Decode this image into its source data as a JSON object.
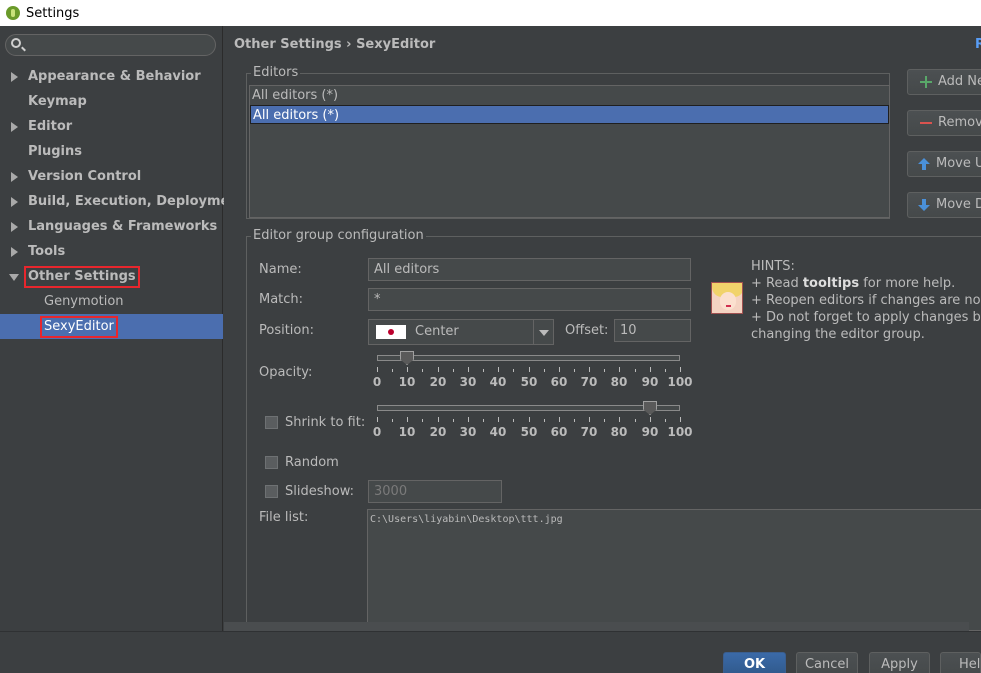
{
  "window": {
    "title": "Settings"
  },
  "search": {
    "placeholder": ""
  },
  "sidebar": {
    "items": [
      {
        "label": "Appearance & Behavior"
      },
      {
        "label": "Keymap"
      },
      {
        "label": "Editor"
      },
      {
        "label": "Plugins"
      },
      {
        "label": "Version Control"
      },
      {
        "label": "Build, Execution, Deployment"
      },
      {
        "label": "Languages & Frameworks"
      },
      {
        "label": "Tools"
      },
      {
        "label": "Other Settings"
      },
      {
        "label": "Genymotion"
      },
      {
        "label": "SexyEditor"
      }
    ]
  },
  "header": {
    "crumb_parent": "Other Settings",
    "separator": "›",
    "crumb_current": "SexyEditor",
    "reset_label": "R"
  },
  "editors": {
    "legend": "Editors",
    "rows": [
      "All editors (*)",
      "All editors (*)"
    ],
    "buttons": {
      "add": "Add Ne",
      "remove": "Remov",
      "move_up": "Move U",
      "move_down": "Move D"
    }
  },
  "config": {
    "legend": "Editor group configuration",
    "name_label": "Name:",
    "name_value": "All editors",
    "match_label": "Match:",
    "match_value": "*",
    "position_label": "Position:",
    "position_value": "Center",
    "offset_label": "Offset:",
    "offset_value": "10",
    "opacity_label": "Opacity:",
    "opacity_value": 10,
    "shrink_label": "Shrink to fit:",
    "shrink_value": 90,
    "random_label": "Random",
    "slideshow_label": "Slideshow:",
    "slideshow_value": "3000",
    "filelist_label": "File list:",
    "filelist_value": "C:\\Users\\liyabin\\Desktop\\ttt.jpg",
    "tick_labels": [
      "0",
      "10",
      "20",
      "30",
      "40",
      "50",
      "60",
      "70",
      "80",
      "90",
      "100"
    ]
  },
  "hints": {
    "title": "HINTS:",
    "line1_prefix": "+ Read ",
    "line1_bold": "tooltips",
    "line1_suffix": " for more help.",
    "line2": "+ Reopen editors if changes are not vis",
    "line3": "+ Do not forget to apply changes befor",
    "line4": "changing the editor group."
  },
  "footer": {
    "ok": "OK",
    "cancel": "Cancel",
    "apply": "Apply",
    "help": "Help"
  },
  "colors": {
    "accent": "#4b6eaf",
    "highlight": "#e8262d",
    "link": "#589df6"
  }
}
